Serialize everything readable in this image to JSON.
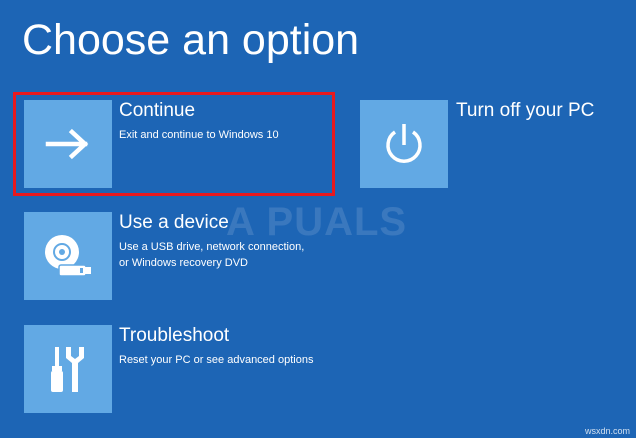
{
  "page": {
    "title": "Choose an option",
    "background_color": "#1d65b5",
    "tile_color": "#62a9e4",
    "highlight_color": "#e8191f"
  },
  "options": [
    {
      "title": "Continue",
      "description_lines": [
        "Exit and continue to Windows 10"
      ],
      "icon": "arrow-right-icon"
    },
    {
      "title": "Turn off your PC",
      "description_lines": [],
      "icon": "power-icon"
    },
    {
      "title": "Use a device",
      "description_lines": [
        "Use a USB drive, network connection,",
        "or Windows recovery DVD"
      ],
      "icon": "disc-drive-icon"
    },
    {
      "title": "Troubleshoot",
      "description_lines": [
        "Reset your PC or see advanced options"
      ],
      "icon": "tools-icon"
    }
  ],
  "watermark": {
    "text": "A PUALS"
  },
  "footer": {
    "credit": "wsxdn.com"
  }
}
